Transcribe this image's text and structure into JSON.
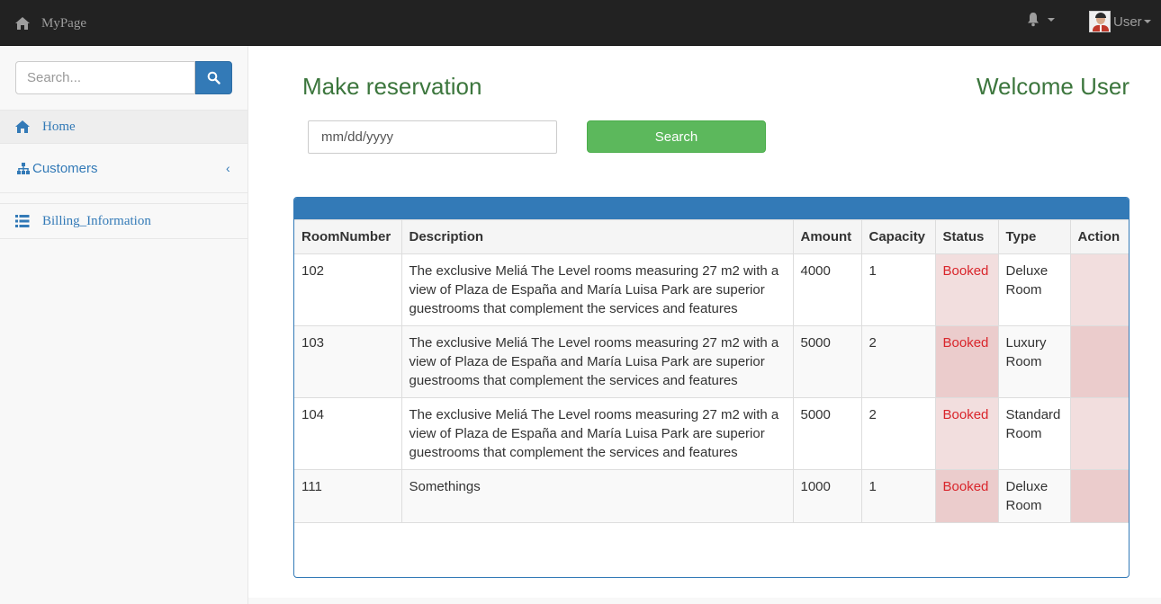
{
  "navbar": {
    "brand": "MyPage",
    "user_label": "User",
    "icons": {
      "brand": "home-icon",
      "notifications": "bell-icon"
    }
  },
  "sidebar": {
    "search_placeholder": "Search...",
    "items": [
      {
        "label": "Home",
        "icon": "home-icon",
        "active": true
      },
      {
        "label": "Customers",
        "icon": "sitemap-icon",
        "chevron": "‹"
      },
      {
        "label": "Billing_Information",
        "icon": "list-icon"
      }
    ]
  },
  "main": {
    "title": "Make reservation",
    "welcome": "Welcome User",
    "date_placeholder": "mm/dd/yyyy",
    "search_button": "Search",
    "table": {
      "columns": [
        "RoomNumber",
        "Description",
        "Amount",
        "Capacity",
        "Status",
        "Type",
        "Action"
      ],
      "rows": [
        {
          "room": "102",
          "description": "The exclusive Meliá The Level rooms measuring 27 m2 with a view of Plaza de España and María Luisa Park are superior guestrooms that complement the services and features",
          "amount": "4000",
          "capacity": "1",
          "status": "Booked",
          "type": "Deluxe Room",
          "action": ""
        },
        {
          "room": "103",
          "description": "The exclusive Meliá The Level rooms measuring 27 m2 with a view of Plaza de España and María Luisa Park are superior guestrooms that complement the services and features",
          "amount": "5000",
          "capacity": "2",
          "status": "Booked",
          "type": "Luxury Room",
          "action": ""
        },
        {
          "room": "104",
          "description": "The exclusive Meliá The Level rooms measuring 27 m2 with a view of Plaza de España and María Luisa Park are superior guestrooms that complement the services and features",
          "amount": "5000",
          "capacity": "2",
          "status": "Booked",
          "type": "Standard Room",
          "action": ""
        },
        {
          "room": "111",
          "description": "Somethings",
          "amount": "1000",
          "capacity": "1",
          "status": "Booked",
          "type": "Deluxe Room",
          "action": ""
        }
      ]
    }
  },
  "colors": {
    "navbar_bg": "#222222",
    "link": "#337ab7",
    "heading_green": "#3c763d",
    "search_button": "#5cb85c",
    "status_text": "#d9252b",
    "status_bg": "#f2dede"
  }
}
